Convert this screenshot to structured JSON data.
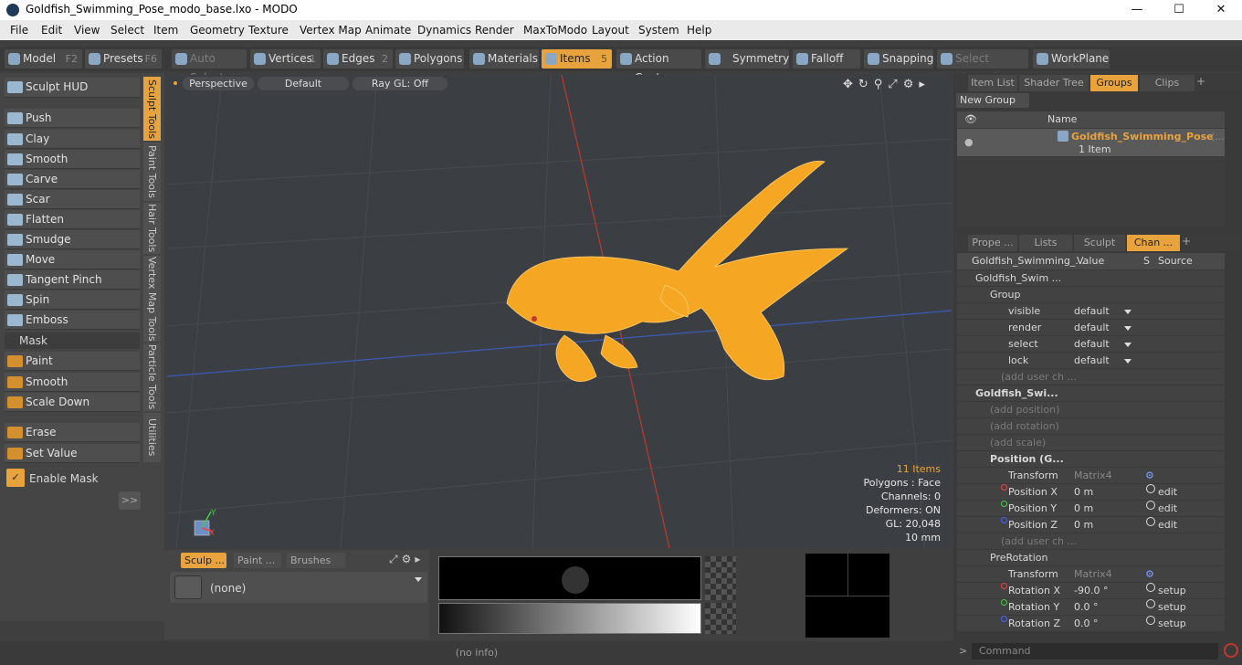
{
  "app": {
    "title": "Goldfish_Swimming_Pose_modo_base.lxo - MODO"
  },
  "menu": [
    "File",
    "Edit",
    "View",
    "Select",
    "Item",
    "Geometry",
    "Texture",
    "Vertex Map",
    "Animate",
    "Dynamics",
    "Render",
    "MaxToModo",
    "Layout",
    "System",
    "Help"
  ],
  "toolbar": {
    "model": "Model",
    "model_key": "F2",
    "presets": "Presets",
    "presets_key": "F6",
    "auto_select": "Auto Select",
    "vertices": "Vertices",
    "vertices_key": "1",
    "edges": "Edges",
    "edges_key": "2",
    "polygons": "Polygons",
    "materials": "Materials",
    "items": "Items",
    "items_key": "5",
    "action_center": "Action Center",
    "symmetry": "Symmetry",
    "falloff": "Falloff",
    "snapping": "Snapping",
    "select_through": "Select Through",
    "workplane": "WorkPlane"
  },
  "left": {
    "hud": "Sculpt HUD",
    "tools": [
      "Push",
      "Clay",
      "Smooth",
      "Carve",
      "Scar",
      "Flatten",
      "Smudge",
      "Move",
      "Tangent Pinch",
      "Spin",
      "Emboss"
    ],
    "mask_header": "Mask",
    "mask_tools": [
      "Paint",
      "Smooth",
      "Scale Down"
    ],
    "erase": "Erase",
    "set_value": "Set Value",
    "enable_mask": "Enable Mask",
    "more": ">>",
    "vtabs": [
      "Sculpt Tools",
      "Paint Tools",
      "Hair Tools",
      "Vertex Map Tools",
      "Particle Tools",
      "Utilities"
    ]
  },
  "viewport": {
    "perspective": "Perspective",
    "default": "Default",
    "raygl": "Ray GL: Off",
    "items_count": "11 Items",
    "polygons": "Polygons : Face",
    "channels": "Channels: 0",
    "deformers": "Deformers: ON",
    "gl": "GL: 20,048",
    "scale": "10 mm"
  },
  "bottom": {
    "tabs": [
      "Sculp ...",
      "Paint ...",
      "Brushes"
    ],
    "none": "(none)"
  },
  "status": {
    "info": "(no info)",
    "command_placeholder": "Command"
  },
  "right": {
    "tabs_top": [
      "Item List",
      "Shader Tree",
      "Groups",
      "Clips"
    ],
    "new_group": "New Group",
    "name_col": "Name",
    "group_name": "Goldfish_Swimming_Pose",
    "group_more": "(...",
    "group_count": "1 Item",
    "tabs_bottom": [
      "Prope ...",
      "Lists",
      "Sculpt",
      "Chan ..."
    ],
    "ch_header": {
      "name": "Goldfish_Swimming_...",
      "value": "Value",
      "s": "S",
      "source": "Source"
    },
    "channels": [
      {
        "n": "Goldfish_Swim ...",
        "v": "",
        "s": "",
        "src": "",
        "ind": 20,
        "bold": false
      },
      {
        "n": "Group",
        "v": "",
        "s": "",
        "src": "",
        "ind": 36,
        "bold": false
      },
      {
        "n": "visible",
        "v": "default",
        "s": "",
        "src": "",
        "ind": 56,
        "dd": true
      },
      {
        "n": "render",
        "v": "default",
        "s": "",
        "src": "",
        "ind": 56,
        "dd": true
      },
      {
        "n": "select",
        "v": "default",
        "s": "",
        "src": "",
        "ind": 56,
        "dd": true
      },
      {
        "n": "lock",
        "v": "default",
        "s": "",
        "src": "",
        "ind": 56,
        "dd": true
      },
      {
        "n": "(add user ch ...",
        "v": "",
        "s": "",
        "src": "",
        "ind": 48,
        "ph": true
      },
      {
        "n": "Goldfish_Swi...",
        "v": "",
        "s": "",
        "src": "",
        "ind": 20,
        "bold": true
      },
      {
        "n": "(add position)",
        "v": "",
        "s": "",
        "src": "",
        "ind": 36,
        "ph": true
      },
      {
        "n": "(add rotation)",
        "v": "",
        "s": "",
        "src": "",
        "ind": 36,
        "ph": true
      },
      {
        "n": "(add scale)",
        "v": "",
        "s": "",
        "src": "",
        "ind": 36,
        "ph": true
      },
      {
        "n": "Position (G...",
        "v": "",
        "s": "",
        "src": "",
        "ind": 36,
        "bold": true
      },
      {
        "n": "Transform",
        "v": "Matrix4",
        "s": "",
        "src": "",
        "ind": 56,
        "dim": true,
        "gear": true
      },
      {
        "n": "Position X",
        "v": "0 m",
        "s": "",
        "src": "edit",
        "ind": 56,
        "dot": "#e44",
        "circ": true
      },
      {
        "n": "Position Y",
        "v": "0 m",
        "s": "",
        "src": "edit",
        "ind": 56,
        "dot": "#4c4",
        "circ": true
      },
      {
        "n": "Position Z",
        "v": "0 m",
        "s": "",
        "src": "edit",
        "ind": 56,
        "dot": "#46f",
        "circ": true
      },
      {
        "n": "(add user ch ...",
        "v": "",
        "s": "",
        "src": "",
        "ind": 48,
        "ph": true
      },
      {
        "n": "PreRotation",
        "v": "",
        "s": "",
        "src": "",
        "ind": 36,
        "bold": false
      },
      {
        "n": "Transform",
        "v": "Matrix4",
        "s": "",
        "src": "",
        "ind": 56,
        "dim": true,
        "gear": true
      },
      {
        "n": "Rotation X",
        "v": "-90.0 °",
        "s": "",
        "src": "setup",
        "ind": 56,
        "dot": "#e44",
        "circ": true
      },
      {
        "n": "Rotation Y",
        "v": "0.0 °",
        "s": "",
        "src": "setup",
        "ind": 56,
        "dot": "#4c4",
        "circ": true
      },
      {
        "n": "Rotation Z",
        "v": "0.0 °",
        "s": "",
        "src": "setup",
        "ind": 56,
        "dot": "#46f",
        "circ": true
      }
    ]
  },
  "colors": {
    "accent": "#e8a33d",
    "fish": "#f5a623",
    "axis_red": "#c0392b",
    "axis_blue": "#3b5bb5"
  }
}
